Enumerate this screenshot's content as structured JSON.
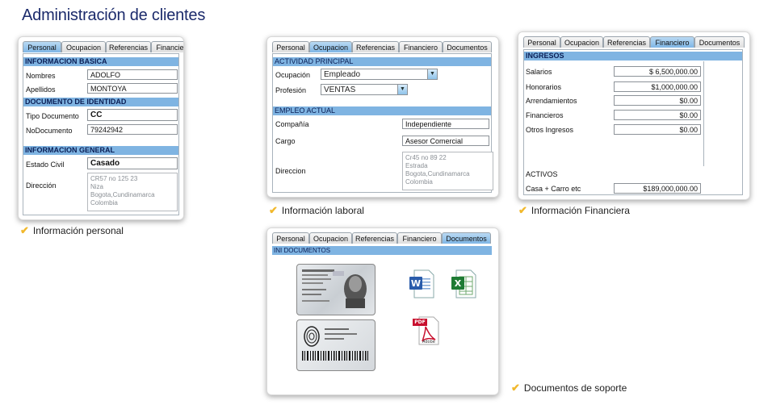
{
  "title": "Administración de clientes",
  "tabs": [
    "Personal",
    "Ocupacion",
    "Referencias",
    "Financiero",
    "Documentos"
  ],
  "personal": {
    "sections": [
      "INFORMACION BASICA",
      "DOCUMENTO DE IDENTIDAD",
      "INFORMACION GENERAL"
    ],
    "fields": [
      {
        "label": "Nombres",
        "value": "ADOLFO"
      },
      {
        "label": "Apellidos",
        "value": "MONTOYA"
      },
      {
        "label": "Tipo Documento",
        "value": "CC"
      },
      {
        "label": "NoDocumento",
        "value": "79242942"
      },
      {
        "label": "Estado Civil",
        "value": "Casado"
      }
    ],
    "address_label": "Dirección",
    "address_lines": [
      "CR57 no 125 23",
      "Niza",
      "Bogota,Cundinamarca",
      "Colombia"
    ],
    "caption": "Información personal"
  },
  "laboral": {
    "sections": [
      "ACTIVIDAD PRINCIPAL",
      "EMPLEO ACTUAL"
    ],
    "ocupacion_label": "Ocupación",
    "ocupacion_value": "Empleado",
    "profesion_label": "Profesión",
    "profesion_value": "VENTAS",
    "fields": [
      {
        "label": "Compañía",
        "value": "Independiente"
      },
      {
        "label": "Cargo",
        "value": "Asesor Comercial"
      }
    ],
    "address_label": "Direccion",
    "address_lines": [
      "Cr45 no 89 22",
      "Estrada",
      "Bogota,Cundinamarca",
      "Colombia"
    ],
    "caption": "Información laboral"
  },
  "financiera": {
    "sections": [
      "INGRESOS"
    ],
    "ingresos": [
      {
        "label": "Salarios",
        "value": "$ 6,500,000.00"
      },
      {
        "label": "Honorarios",
        "value": "$1,000,000.00"
      },
      {
        "label": "Arrendamientos",
        "value": "$0.00"
      },
      {
        "label": "Financieros",
        "value": "$0.00"
      },
      {
        "label": "Otros Ingresos",
        "value": "$0.00"
      }
    ],
    "activos_label": "ACTIVOS",
    "activos": [
      {
        "label": "Casa + Carro etc",
        "value": "$189,000,000.00"
      }
    ],
    "caption": "Información Financiera"
  },
  "documentos": {
    "section": "INI DOCUMENTOS",
    "caption": "Documentos de soporte",
    "icons": [
      "id-card-front-icon",
      "id-card-back-icon",
      "word-document-icon",
      "excel-document-icon",
      "pdf-document-icon"
    ],
    "pdf_badge": "PDF",
    "pdf_brand": "Adobe"
  },
  "colors": {
    "title": "#1b2a6b",
    "section_header": "#7fb4e2",
    "active_tab": "#7fb6e6",
    "check": "#f1b82c"
  }
}
